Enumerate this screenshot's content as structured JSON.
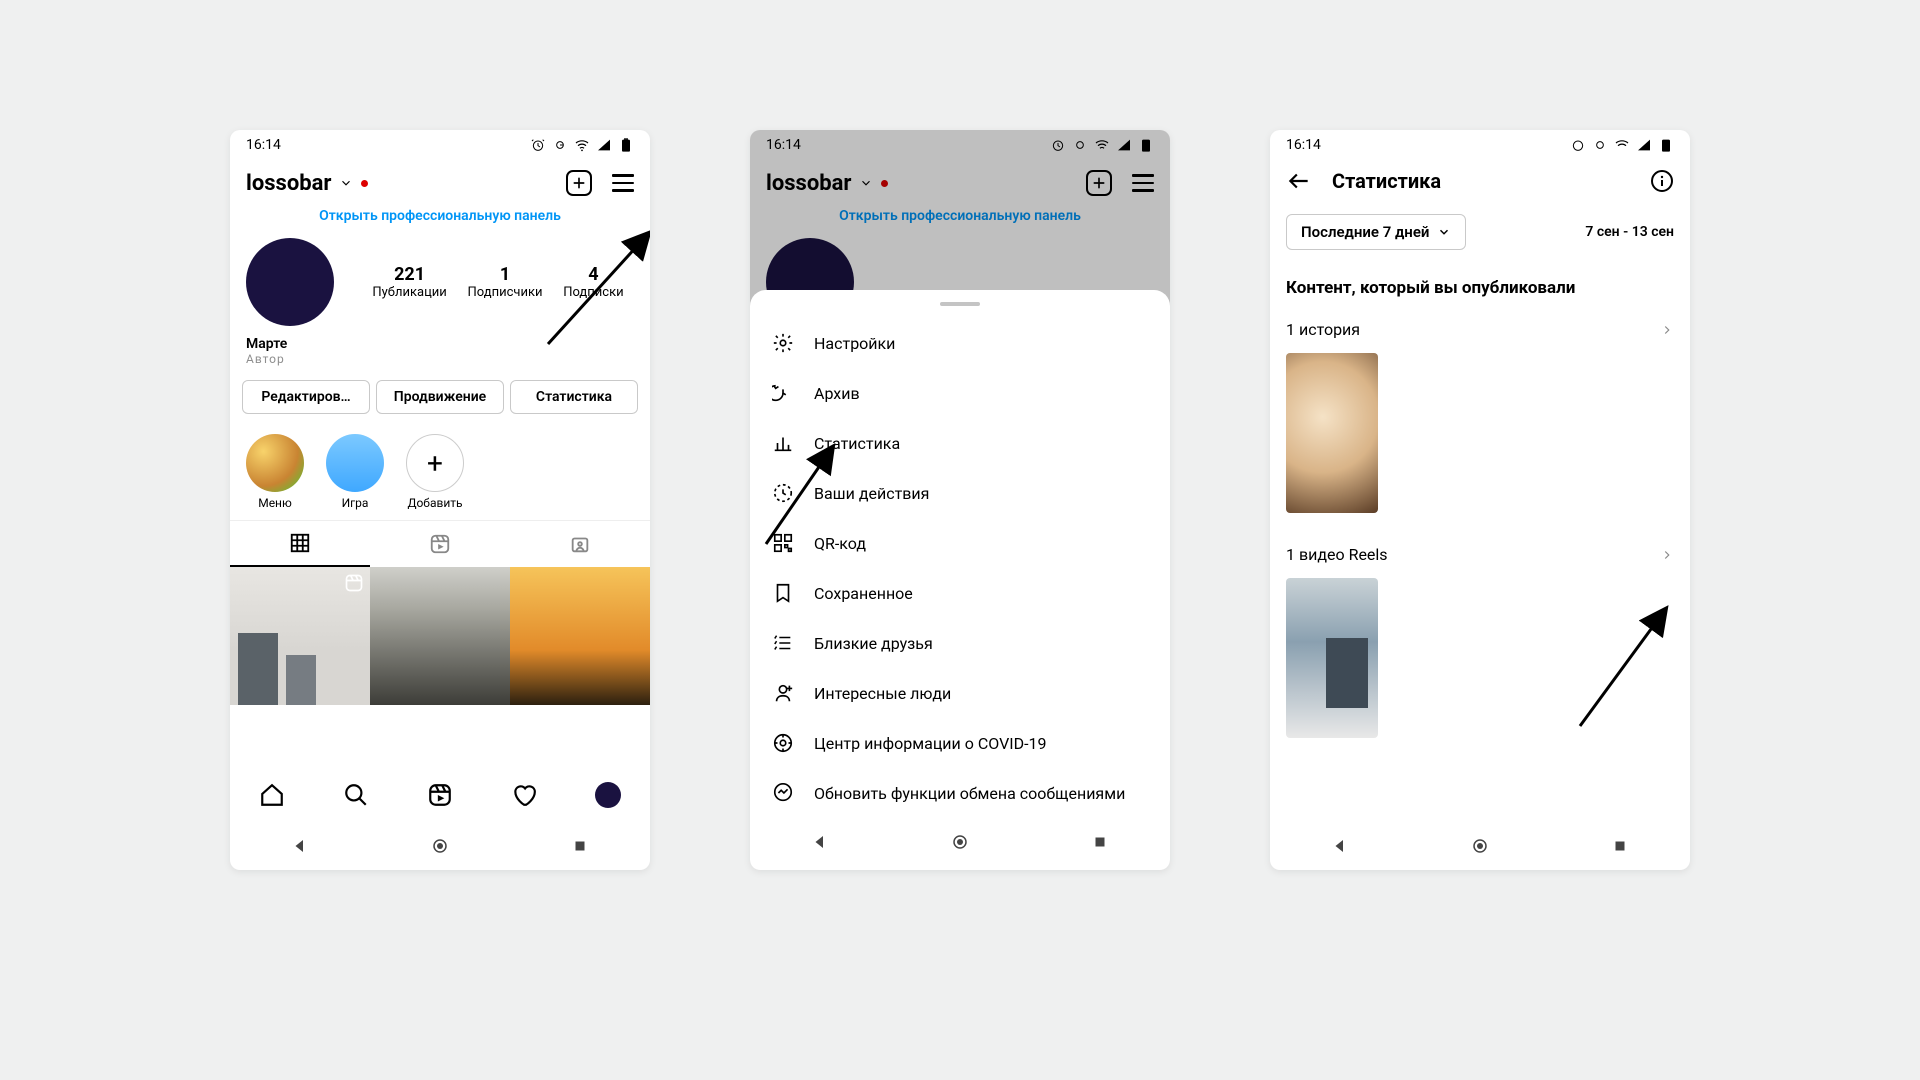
{
  "status_time": "16:14",
  "profile": {
    "username": "lossobar",
    "pro_panel_link": "Открыть профессиональную панель",
    "stats": {
      "posts_num": "221",
      "posts_label": "Публикации",
      "followers_num": "1",
      "followers_label": "Подписчики",
      "following_num": "4",
      "following_label": "Подписки"
    },
    "name": "Марте",
    "author": "Автор",
    "btn_edit": "Редактиров…",
    "btn_promo": "Продвижение",
    "btn_stats": "Статистика",
    "highlight_menu": "Меню",
    "highlight_game": "Игра",
    "highlight_add": "Добавить"
  },
  "menu": {
    "settings": "Настройки",
    "archive": "Архив",
    "stats": "Статистика",
    "your_actions": "Ваши действия",
    "qr": "QR-код",
    "saved": "Сохраненное",
    "close_friends": "Близкие друзья",
    "discover": "Интересные люди",
    "covid": "Центр информации о COVID-19",
    "messaging": "Обновить функции обмена сообщениями"
  },
  "stats_page": {
    "title": "Статистика",
    "period_btn": "Последние 7 дней",
    "date_range": "7 сен - 13 сен",
    "section_title": "Контент, который вы опубликовали",
    "story_label": "1 история",
    "reels_label": "1 видео Reels"
  }
}
